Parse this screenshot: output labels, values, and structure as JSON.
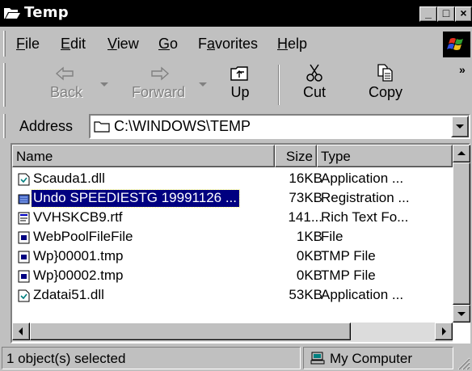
{
  "window": {
    "title": "Temp",
    "title_icon": "open-folder-icon",
    "controls": {
      "minimize": "_",
      "maximize": "□",
      "close": "×"
    }
  },
  "menu": {
    "items": [
      "File",
      "Edit",
      "View",
      "Go",
      "Favorites",
      "Help"
    ],
    "mnemonics": [
      "F",
      "E",
      "V",
      "G",
      "a",
      "H"
    ],
    "logo_icon": "windows-logo-icon"
  },
  "toolbar": {
    "back": {
      "label": "Back",
      "icon": "back-arrow-icon",
      "enabled": false
    },
    "forward": {
      "label": "Forward",
      "icon": "forward-arrow-icon",
      "enabled": false
    },
    "up": {
      "label": "Up",
      "icon": "up-folder-icon"
    },
    "cut": {
      "label": "Cut",
      "icon": "scissors-icon"
    },
    "copy": {
      "label": "Copy",
      "icon": "copy-icon"
    },
    "overflow": "»"
  },
  "address": {
    "label": "Address",
    "value": "C:\\WINDOWS\\TEMP"
  },
  "list": {
    "columns": [
      "Name",
      "Size",
      "Type"
    ],
    "rows": [
      {
        "name": "Scauda1.dll",
        "size": "16KB",
        "type": "Application ...",
        "icon": "dll-icon"
      },
      {
        "name": "Undo SPEEDIESTG 19991126 ...",
        "size": "73KB",
        "type": "Registration ...",
        "icon": "registry-icon",
        "selected": true
      },
      {
        "name": "VVHSKCB9.rtf",
        "size": "141...",
        "type": "Rich Text Fo...",
        "icon": "rtf-icon"
      },
      {
        "name": "WebPoolFileFile",
        "size": "1KB",
        "type": "File",
        "icon": "file-icon"
      },
      {
        "name": "Wp}00001.tmp",
        "size": "0KB",
        "type": "TMP File",
        "icon": "file-icon"
      },
      {
        "name": "Wp}00002.tmp",
        "size": "0KB",
        "type": "TMP File",
        "icon": "file-icon"
      },
      {
        "name": "Zdatai51.dll",
        "size": "53KB",
        "type": "Application ...",
        "icon": "dll-icon"
      }
    ]
  },
  "status": {
    "selection": "1 object(s) selected",
    "zone": "My Computer",
    "zone_icon": "my-computer-icon"
  }
}
